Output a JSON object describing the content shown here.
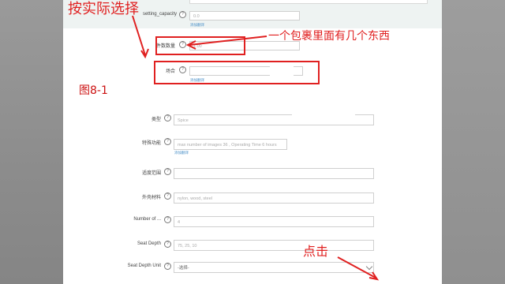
{
  "annotations": {
    "top_left": "按实际选择",
    "item_count_note": "一个包裹里面有几个东西",
    "figure_label": "图8-1",
    "click_note": "点击"
  },
  "upper_form": {
    "setting_capacity": {
      "label": "setting_capacity",
      "value": "0.0",
      "hint": "添加翻译"
    },
    "items_per_pack": {
      "label": "件数数量",
      "value": "1.00",
      "hint": ""
    },
    "location": {
      "label": "场合",
      "value": "",
      "hint": "添加翻译"
    }
  },
  "lower_form": {
    "type": {
      "label": "类型",
      "placeholder": "Spice"
    },
    "special_feature": {
      "label": "特殊功能",
      "placeholder": "max number of images 36 , Operating Time 6 hours",
      "hint": "添加翻译"
    },
    "scope": {
      "label": "适度范围",
      "placeholder": ""
    },
    "outer_material": {
      "label": "外壳材料",
      "placeholder": "nylon, wood, steel"
    },
    "number_of": {
      "label": "Number of ...",
      "placeholder": "4"
    },
    "seat_depth": {
      "label": "Seat Depth",
      "placeholder": "75, 25, 10"
    },
    "seat_depth_unit": {
      "label": "Seat Depth Unit",
      "selected": "-选择-"
    }
  }
}
